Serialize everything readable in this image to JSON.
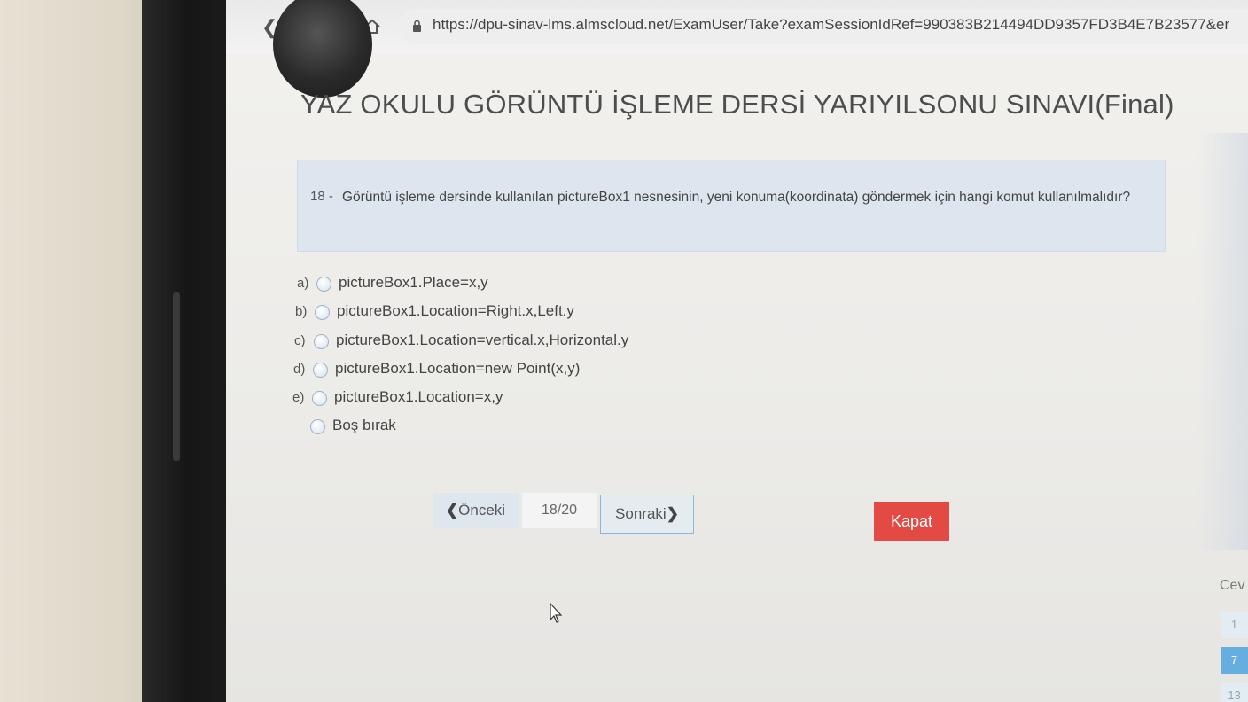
{
  "browser": {
    "url": "https://dpu-sinav-lms.almscloud.net/ExamUser/Take?examSessionIdRef=990383B214494DD9357FD3B4E7B23577&er"
  },
  "exam": {
    "title": "YAZ OKULU GÖRÜNTÜ İŞLEME DERSİ YARIYILSONU SINAVI(Final)"
  },
  "question": {
    "number": "18 -",
    "text": "Görüntü işleme dersinde kullanılan pictureBox1 nesnesinin, yeni konuma(koordinata) göndermek için hangi komut kullanılmalıdır?"
  },
  "options": [
    {
      "letter": "a)",
      "label": "pictureBox1.Place=x,y"
    },
    {
      "letter": "b)",
      "label": "pictureBox1.Location=Right.x,Left.y"
    },
    {
      "letter": "c)",
      "label": "pictureBox1.Location=vertical.x,Horizontal.y"
    },
    {
      "letter": "d)",
      "label": "pictureBox1.Location=new Point(x,y)"
    },
    {
      "letter": "e)",
      "label": "pictureBox1.Location=x,y"
    },
    {
      "letter": "",
      "label": "Boş bırak"
    }
  ],
  "pager": {
    "prev_label": "Önceki",
    "counter": "18/20",
    "next_label": "Sonraki"
  },
  "close_label": "Kapat",
  "sidebar": {
    "label": "Cev",
    "numbers": [
      "1",
      "7",
      "13"
    ]
  },
  "colors": {
    "close_button": "#e24a43",
    "question_panel": "#dde6ee",
    "active_number": "#66aee0"
  }
}
